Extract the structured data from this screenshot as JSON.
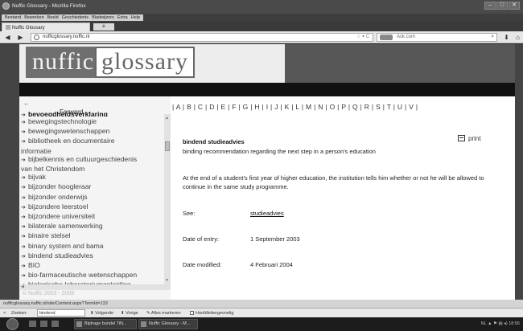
{
  "window": {
    "title": "Nuffic Glossary - Mozilla Firefox",
    "buttons": {
      "minimize": "–",
      "maximize": "□",
      "close": "✕"
    }
  },
  "menubar": {
    "items": [
      "Bestand",
      "Bewerken",
      "Beeld",
      "Geschiedenis",
      "Bladwijzers",
      "Extra",
      "Help"
    ]
  },
  "tabs": [
    {
      "label": "Nuffic Glossary"
    }
  ],
  "newtab_label": "+",
  "navbar": {
    "back": "◀",
    "forward": "▶",
    "url": "nufficglossary.nuffic.nl",
    "url_icons": "☆ ▾ C",
    "search_placeholder": "Ask.com",
    "search_icon": "⌕",
    "download": "⬇",
    "home": "⌂"
  },
  "header": {
    "logo_part1": "nuffic",
    "logo_part2": "glossary"
  },
  "sidebar": {
    "back_label": "←",
    "forward_label": "Forward →",
    "arrow_glyph": "➔",
    "items": [
      {
        "label": "bevoegdheidsverklaring"
      },
      {
        "label": "bewegingstechnologie"
      },
      {
        "label": "bewegingswetenschappen"
      },
      {
        "label": "bibliotheek en documentaire"
      },
      {
        "label": "informatie",
        "continued": true
      },
      {
        "label": "bijbelkennis en cultuurgeschiedenis"
      },
      {
        "label": "van het Christendom",
        "continued": true
      },
      {
        "label": "bijvak"
      },
      {
        "label": "bijzonder hoogleraar"
      },
      {
        "label": "bijzonder onderwijs"
      },
      {
        "label": "bijzondere leerstoel"
      },
      {
        "label": "bijzondere universiteit"
      },
      {
        "label": "bilaterale samenwerking"
      },
      {
        "label": "binaire stelsel"
      },
      {
        "label": "binary system and bama"
      },
      {
        "label": "bindend studieadvies"
      },
      {
        "label": "BIO"
      },
      {
        "label": "bio-farmaceutische wetenschappen"
      },
      {
        "label": "biologische laboratoriumopleiding"
      }
    ],
    "footer_text": "© Nuffic 2003 - 2008"
  },
  "alphabet": [
    "A",
    "B",
    "C",
    "D",
    "E",
    "F",
    "G",
    "H",
    "I",
    "J",
    "K",
    "L",
    "M",
    "N",
    "O",
    "P",
    "Q",
    "R",
    "S",
    "T",
    "U",
    "V"
  ],
  "entry": {
    "term": "bindend studieadvies",
    "print_label": "print",
    "translation": "binding recommendation regarding the next step in a person's education",
    "description": "At the end of a student's first year of higher education, the institution tells him whether or not he will be allowed to continue in the same study programme.",
    "see_label": "See:",
    "see_link": "studieadvies",
    "date_entry_label": "Date of entry:",
    "date_entry_value": "1 September 2003",
    "date_modified_label": "Date modified:",
    "date_modified_value": "4 Februari 2004"
  },
  "statusbar": {
    "url": "nufficglossary.nuffic.nl/site/Content.aspx?TermId=133"
  },
  "findbar": {
    "close": "×",
    "label": "Zoeken:",
    "value": "bindend",
    "next": "⬇ Volgende",
    "prev": "⬆ Vorige",
    "highlight": "Alles markeren",
    "matchcase": "Hoofdlettergevoelig"
  },
  "taskbar": {
    "tasks": [
      {
        "label": "Bijdrage bundel TiN..."
      },
      {
        "label": "Nuffic Glossary - M..."
      }
    ],
    "tray_text": "NL  ▲ ⚑ ▤ ◂) 18:56"
  }
}
